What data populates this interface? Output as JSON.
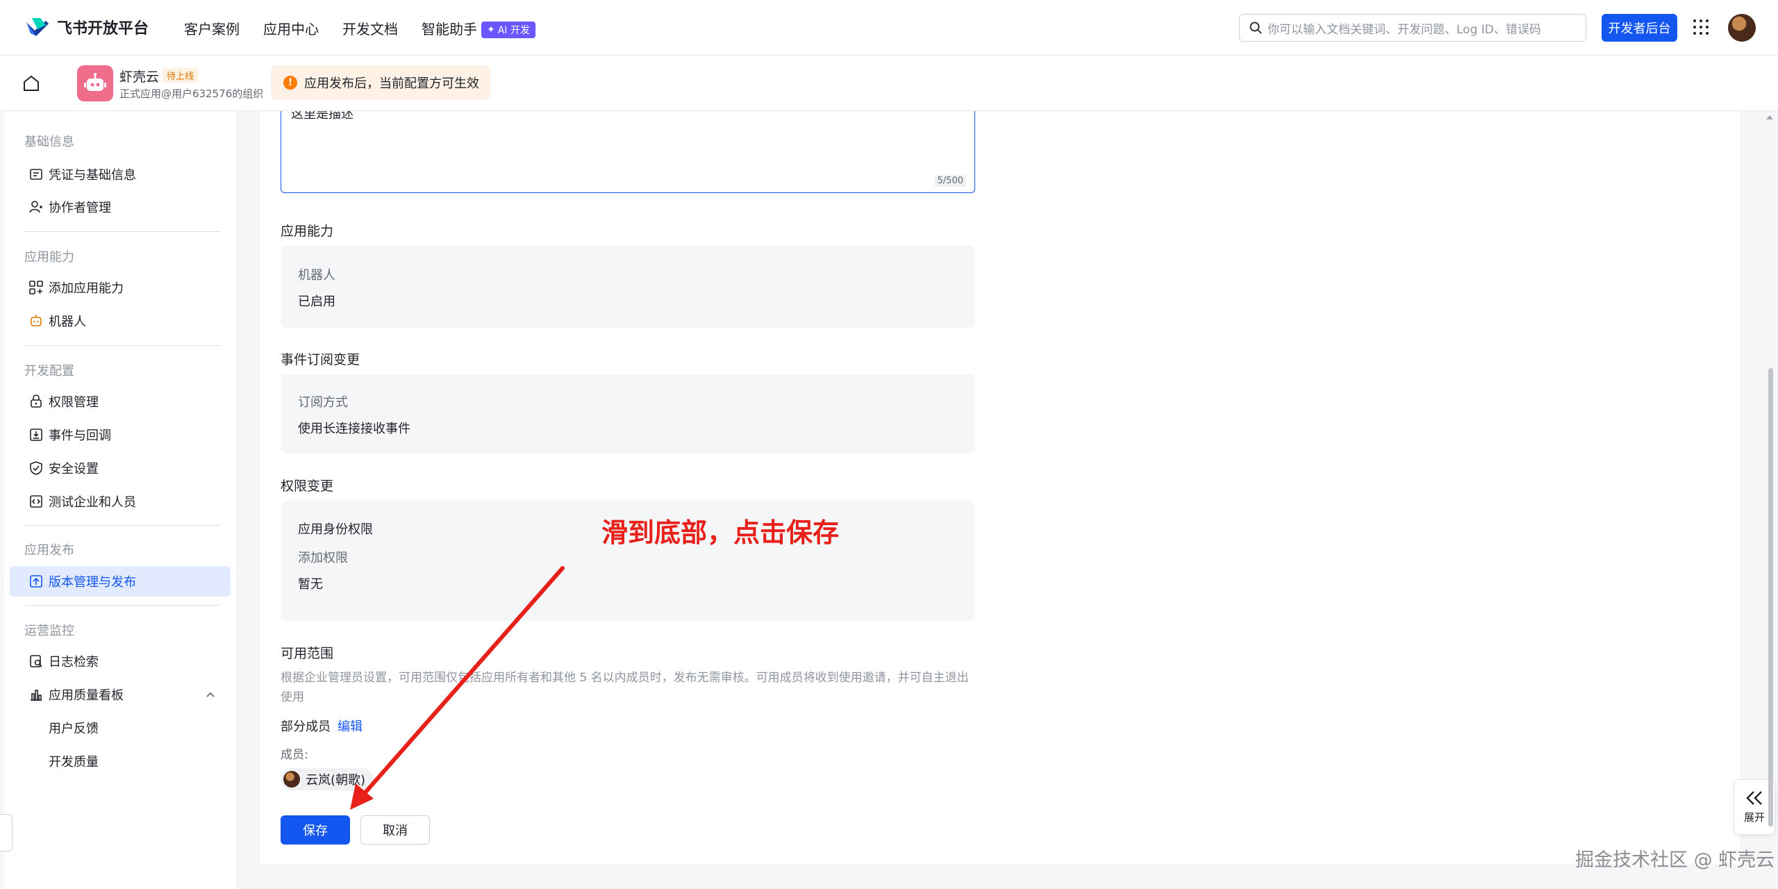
{
  "topbar": {
    "logo_text": "飞书开放平台",
    "nav": [
      "客户案例",
      "应用中心",
      "开发文档",
      "智能助手"
    ],
    "ai_badge": "AI 开发",
    "search_placeholder": "你可以输入文档关键词、开发问题、Log ID、错误码",
    "dev_console": "开发者后台"
  },
  "appbar": {
    "app_name": "虾壳云",
    "app_tag": "待上线",
    "app_sub": "正式应用@用户632576的组织",
    "notice": "应用发布后，当前配置方可生效"
  },
  "sidebar": {
    "group_basic": "基础信息",
    "item_credentials": "凭证与基础信息",
    "item_collaborators": "协作者管理",
    "group_capability": "应用能力",
    "item_add_capability": "添加应用能力",
    "item_bot": "机器人",
    "group_dev": "开发配置",
    "item_permissions": "权限管理",
    "item_events": "事件与回调",
    "item_security": "安全设置",
    "item_test": "测试企业和人员",
    "group_release": "应用发布",
    "item_version": "版本管理与发布",
    "group_ops": "运营监控",
    "item_logs": "日志检索",
    "item_quality": "应用质量看板",
    "item_feedback": "用户反馈",
    "item_dev_quality": "开发质量"
  },
  "form": {
    "textarea_value": "这里是描述",
    "counter_current": "5",
    "counter_max": "/500",
    "capability_title": "应用能力",
    "capability_label": "机器人",
    "capability_value": "已启用",
    "event_title": "事件订阅变更",
    "event_label": "订阅方式",
    "event_value": "使用长连接接收事件",
    "perm_title": "权限变更",
    "perm_identity": "应用身份权限",
    "perm_add_label": "添加权限",
    "perm_add_value": "暂无",
    "scope_title": "可用范围",
    "scope_desc": "根据企业管理员设置，可用范围仅包括应用所有者和其他 5 名以内成员时，发布无需审核。可用成员将收到使用邀请，并可自主退出使用",
    "scope_partial": "部分成员",
    "scope_edit": "编辑",
    "members_label": "成员:",
    "member_name": "云岚(朝歌)",
    "save": "保存",
    "cancel": "取消"
  },
  "annotation": "滑到底部，点击保存",
  "expand_label": "展开",
  "watermark": "掘金技术社区 @ 虾壳云",
  "colors": {
    "primary": "#1456f0",
    "annotation": "#e8201a",
    "notice_bg": "#fff1e6"
  }
}
